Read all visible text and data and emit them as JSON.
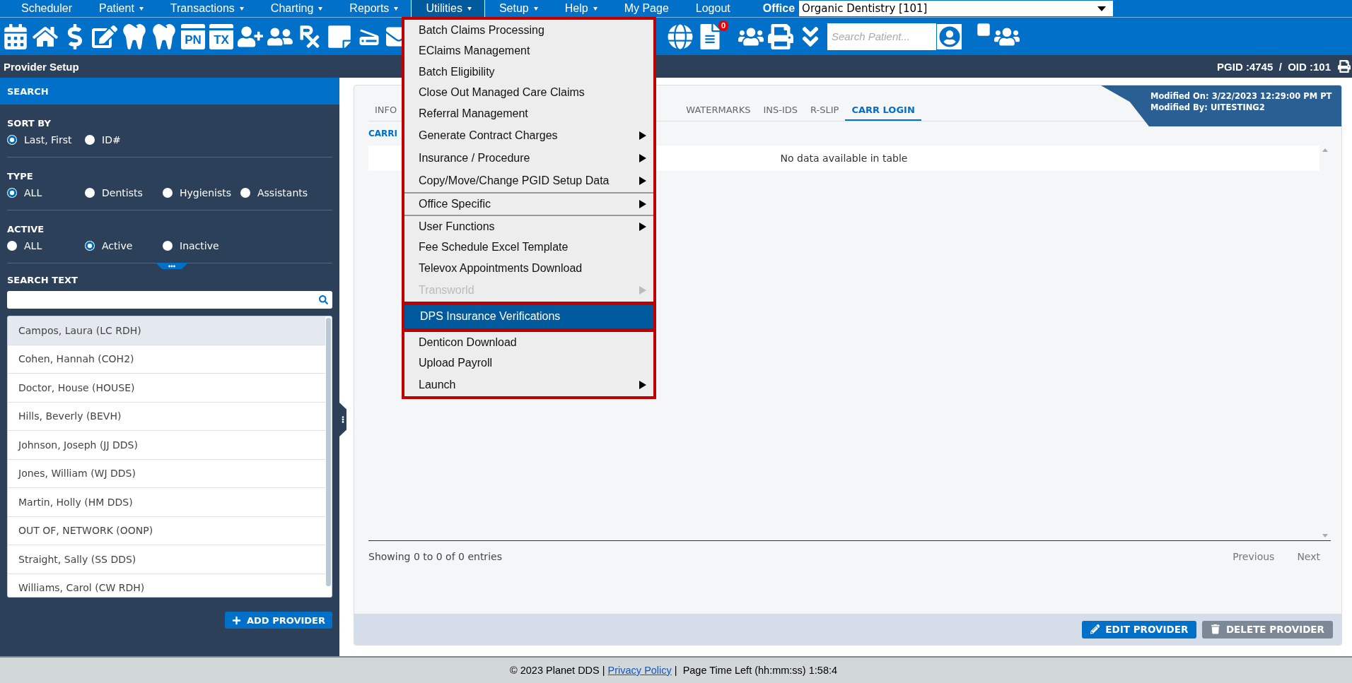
{
  "nav": {
    "items": [
      {
        "label": "Scheduler",
        "dropdown": false,
        "selected": false
      },
      {
        "label": "Patient",
        "dropdown": true,
        "selected": false
      },
      {
        "label": "Transactions",
        "dropdown": true,
        "selected": false
      },
      {
        "label": "Charting",
        "dropdown": true,
        "selected": false
      },
      {
        "label": "Reports",
        "dropdown": true,
        "selected": false
      },
      {
        "label": "Utilities",
        "dropdown": true,
        "selected": true
      },
      {
        "label": "Setup",
        "dropdown": true,
        "selected": false
      },
      {
        "label": "Help",
        "dropdown": true,
        "selected": false
      },
      {
        "label": "My Page",
        "dropdown": false,
        "selected": false
      },
      {
        "label": "Logout",
        "dropdown": false,
        "selected": false
      }
    ],
    "office_label": "Office",
    "office_value": "Organic Dentistry [101]"
  },
  "toolbar": {
    "pn_label": "PN",
    "tx_label": "TX",
    "badge": "0",
    "search_placeholder": "Search Patient...",
    "checkbox_checked": false
  },
  "page_bar": {
    "title": "Provider Setup",
    "ids": "PGID :4745  /  OID :101"
  },
  "utilities_menu": {
    "sections": [
      {
        "items": [
          {
            "label": "Batch Claims Processing",
            "submenu": false,
            "disabled": false,
            "selected": false,
            "divider_before": false
          },
          {
            "label": "EClaims Management",
            "submenu": false,
            "disabled": false,
            "selected": false,
            "divider_before": false
          },
          {
            "label": "Batch Eligibility",
            "submenu": false,
            "disabled": false,
            "selected": false,
            "divider_before": false
          },
          {
            "label": "Close Out Managed Care Claims",
            "submenu": false,
            "disabled": false,
            "selected": false,
            "divider_before": false
          },
          {
            "label": "Referral Management",
            "submenu": false,
            "disabled": false,
            "selected": false,
            "divider_before": false
          },
          {
            "label": "Generate Contract Charges",
            "submenu": true,
            "disabled": false,
            "selected": false,
            "divider_before": false
          },
          {
            "label": "Insurance / Procedure",
            "submenu": true,
            "disabled": false,
            "selected": false,
            "divider_before": false
          },
          {
            "label": "Copy/Move/Change PGID Setup Data",
            "submenu": true,
            "disabled": false,
            "selected": false,
            "divider_before": false
          },
          {
            "label": "Office Specific",
            "submenu": true,
            "disabled": false,
            "selected": false,
            "divider_before": true
          },
          {
            "label": "User Functions",
            "submenu": true,
            "disabled": false,
            "selected": false,
            "divider_before": true
          },
          {
            "label": "Fee Schedule Excel Template",
            "submenu": false,
            "disabled": false,
            "selected": false,
            "divider_before": false
          },
          {
            "label": "Televox Appointments Download",
            "submenu": false,
            "disabled": false,
            "selected": false,
            "divider_before": false
          },
          {
            "label": "Transworld",
            "submenu": true,
            "disabled": true,
            "selected": false,
            "divider_before": false
          }
        ]
      },
      {
        "items": [
          {
            "label": "DPS Insurance Verifications",
            "submenu": false,
            "disabled": false,
            "selected": true,
            "divider_before": false
          }
        ]
      },
      {
        "items": [
          {
            "label": "Denticon Download",
            "submenu": false,
            "disabled": false,
            "selected": false,
            "divider_before": false
          },
          {
            "label": "Upload Payroll",
            "submenu": false,
            "disabled": false,
            "selected": false,
            "divider_before": false
          },
          {
            "label": "Launch",
            "submenu": true,
            "disabled": false,
            "selected": false,
            "divider_before": false
          }
        ]
      }
    ]
  },
  "sidebar": {
    "header": "SEARCH",
    "groups": [
      {
        "title": "SORT BY",
        "options": [
          {
            "label": "Last, First",
            "selected": true
          },
          {
            "label": "ID#",
            "selected": false
          }
        ]
      },
      {
        "title": "TYPE",
        "options": [
          {
            "label": "ALL",
            "selected": true
          },
          {
            "label": "Dentists",
            "selected": false
          },
          {
            "label": "Hygienists",
            "selected": false
          },
          {
            "label": "Assistants",
            "selected": false
          }
        ]
      },
      {
        "title": "ACTIVE",
        "options": [
          {
            "label": "ALL",
            "selected": false
          },
          {
            "label": "Active",
            "selected": true
          },
          {
            "label": "Inactive",
            "selected": false
          }
        ]
      }
    ],
    "search_title": "SEARCH TEXT",
    "providers": [
      {
        "name": "Campos, Laura (LC RDH)",
        "selected": true
      },
      {
        "name": "Cohen, Hannah (COH2)",
        "selected": false
      },
      {
        "name": "Doctor, House (HOUSE)",
        "selected": false
      },
      {
        "name": "Hills, Beverly (BEVH)",
        "selected": false
      },
      {
        "name": "Johnson, Joseph (JJ DDS)",
        "selected": false
      },
      {
        "name": "Jones, William (WJ DDS)",
        "selected": false
      },
      {
        "name": "Martin, Holly (HM DDS)",
        "selected": false
      },
      {
        "name": "OUT OF, NETWORK (OONP)",
        "selected": false
      },
      {
        "name": "Straight, Sally (SS DDS)",
        "selected": false
      },
      {
        "name": "Williams, Carol (CW RDH)",
        "selected": false
      }
    ],
    "add_button": "ADD PROVIDER"
  },
  "main": {
    "modified_on": "Modified On: 3/22/2023 12:29:00 PM PT",
    "modified_by": "Modified By: UITESTING2",
    "tabs": [
      {
        "label": "INFO",
        "selected": false
      },
      {
        "label": "WATERMARKS",
        "selected": false
      },
      {
        "label": "INS-IDS",
        "selected": false
      },
      {
        "label": "R-SLIP",
        "selected": false
      },
      {
        "label": "CARR LOGIN",
        "selected": true
      }
    ],
    "sub_tab": "CARRI",
    "empty_text": "No data available in table",
    "info": "Showing 0 to 0 of 0 entries",
    "pager": [
      "Previous",
      "Next"
    ],
    "edit_button": "EDIT PROVIDER",
    "delete_button": "DELETE PROVIDER"
  },
  "footer": {
    "before": "© 2023 Planet DDS |",
    "link": "Privacy Policy",
    "after": "|  Page Time Left (hh:mm:ss) 1:58:4"
  }
}
